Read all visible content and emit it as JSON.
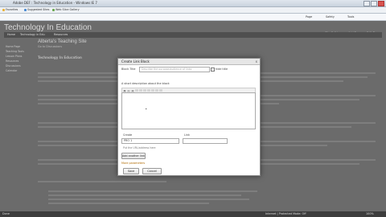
{
  "browser": {
    "title": "Adobe DEF : Technology in Education - Windows IE 7",
    "favorites": [
      "Favorites",
      "Suggested Sites",
      "Web Slice Gallery"
    ],
    "commands": [
      "Page",
      "Safety",
      "Tools"
    ],
    "zoom": "100%"
  },
  "site": {
    "title": "Technology In Education",
    "nav": [
      "Home",
      "Technology in Edu",
      "Resources"
    ],
    "right_links": [
      "Site Settings",
      "Add Page",
      "Edit Page"
    ],
    "sidebar": [
      "Home Page",
      "Teaching Tools",
      "Lesson Plans",
      "Resources",
      "Discussions",
      "Calendar"
    ],
    "page_heading": "Alberta's Teaching Site",
    "page_sub": "Go to Discussions",
    "page_h2": "Technology In Education"
  },
  "dialog": {
    "title": "Create Link Block",
    "close": "x",
    "block_title_label": "Block Title",
    "block_title_placeholder": "Describe the purpose/audience of links",
    "hide_title_label": "hide title",
    "description_label": "A short description about the block",
    "create_label": "Create",
    "link_label": "Link",
    "create_value": "PRO 1",
    "link_value": "",
    "url_hint": "Put the URL/address here",
    "add_button": "Add another link",
    "more_options": "More parameters",
    "save_button": "Save",
    "cancel_button": "Cancel"
  },
  "status": {
    "left": "Done",
    "zone": "Internet | Protected Mode: Off",
    "zoom": "100%"
  }
}
